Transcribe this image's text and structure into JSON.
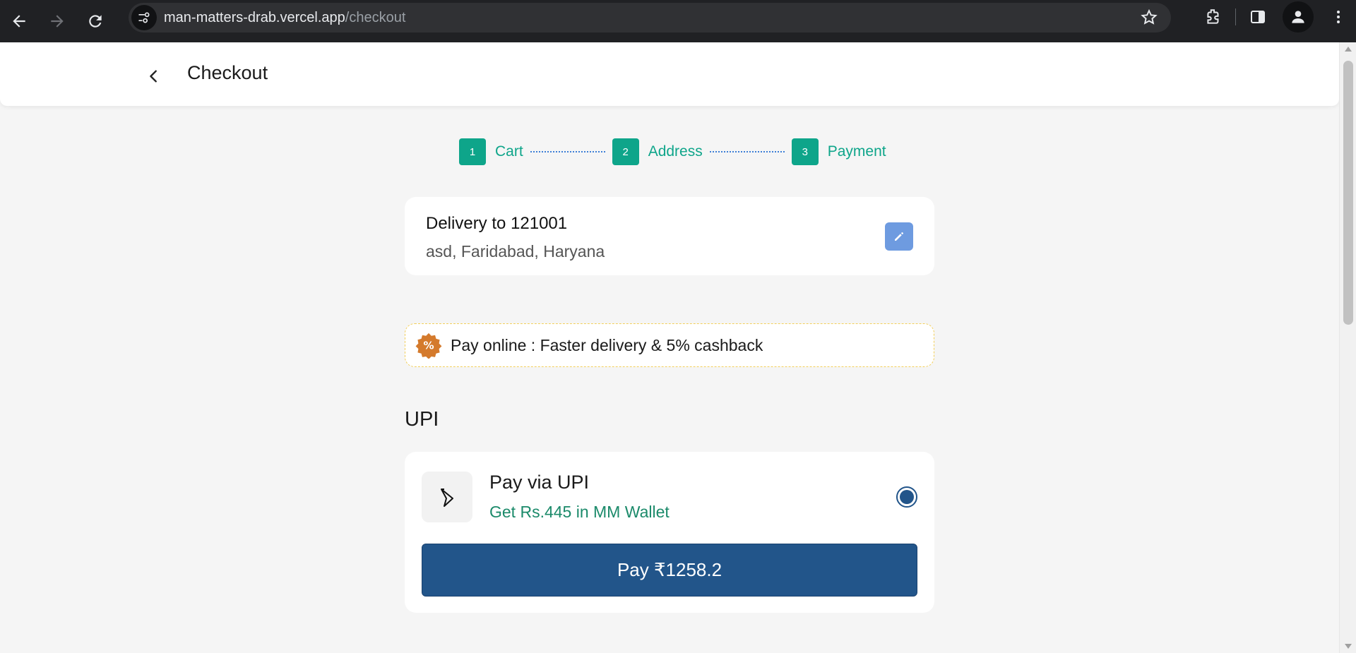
{
  "browser": {
    "url_host": "man-matters-drab.vercel.app",
    "url_path": "/checkout"
  },
  "header": {
    "title": "Checkout"
  },
  "stepper": {
    "steps": [
      {
        "num": "1",
        "label": "Cart"
      },
      {
        "num": "2",
        "label": "Address"
      },
      {
        "num": "3",
        "label": "Payment"
      }
    ]
  },
  "delivery": {
    "title": "Delivery to 121001",
    "address": "asd, Faridabad, Haryana"
  },
  "promo": {
    "text": "Pay online : Faster delivery & 5% cashback"
  },
  "payment": {
    "section_title": "UPI",
    "option_name": "Pay via UPI",
    "option_sub": "Get Rs.445 in MM Wallet",
    "selected": true,
    "pay_label": "Pay ₹1258.2"
  },
  "colors": {
    "accent_green": "#0ea58a",
    "primary_blue": "#22558a",
    "edit_blue": "#6e9be0"
  }
}
